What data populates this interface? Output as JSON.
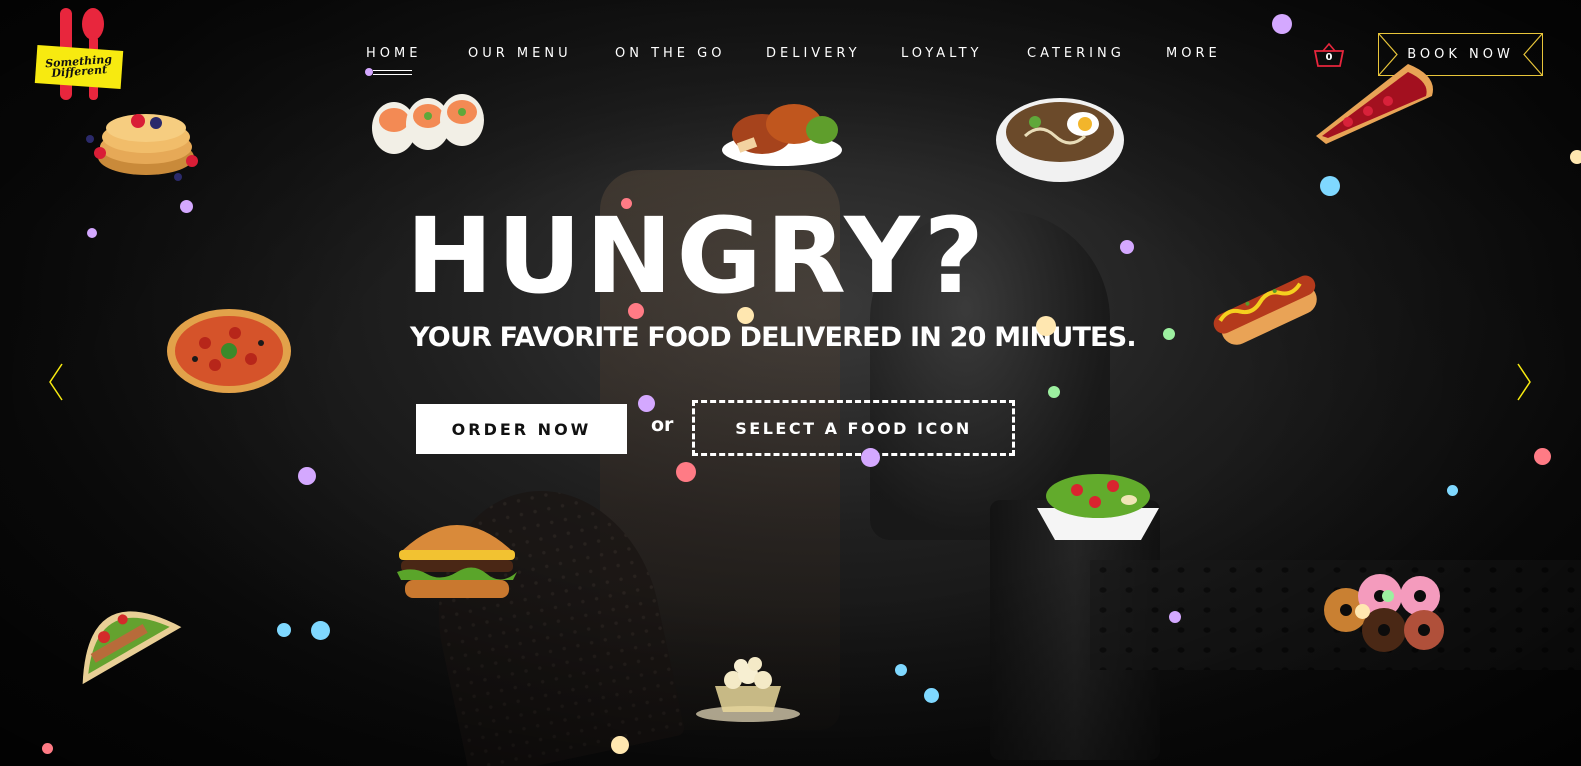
{
  "logo": {
    "text": "Something Different"
  },
  "nav": {
    "items": [
      "HOME",
      "OUR MENU",
      "ON THE GO",
      "DELIVERY",
      "LOYALTY",
      "CATERING",
      "MORE"
    ],
    "active": "HOME"
  },
  "cart": {
    "count": "0",
    "icon": "basket-icon"
  },
  "book_button": "BOOK NOW",
  "hero": {
    "title": "HUNGRY?",
    "subtitle": "YOUR FAVORITE FOOD DELIVERED IN 20 MINUTES.",
    "order_button": "ORDER NOW",
    "or_text": "or",
    "select_button": "SELECT A FOOD ICON"
  },
  "carousel": {
    "prev_icon": "chevron-left-icon",
    "next_icon": "chevron-right-icon"
  },
  "food_icons": [
    "pancakes",
    "sushi",
    "roast-chicken",
    "ramen",
    "cherry-pie",
    "pizza",
    "hot-dog",
    "burger",
    "salad",
    "taco",
    "popcorn",
    "donuts"
  ],
  "colors": {
    "accent_yellow": "#f7ea10",
    "accent_red": "#e8263d",
    "book_border": "#e8c53a",
    "dot_purple": "#d4a8ff",
    "dot_pink": "#ff7b85",
    "dot_blue": "#7fd8ff",
    "dot_cream": "#ffe7b0",
    "dot_green": "#9df0a0"
  }
}
